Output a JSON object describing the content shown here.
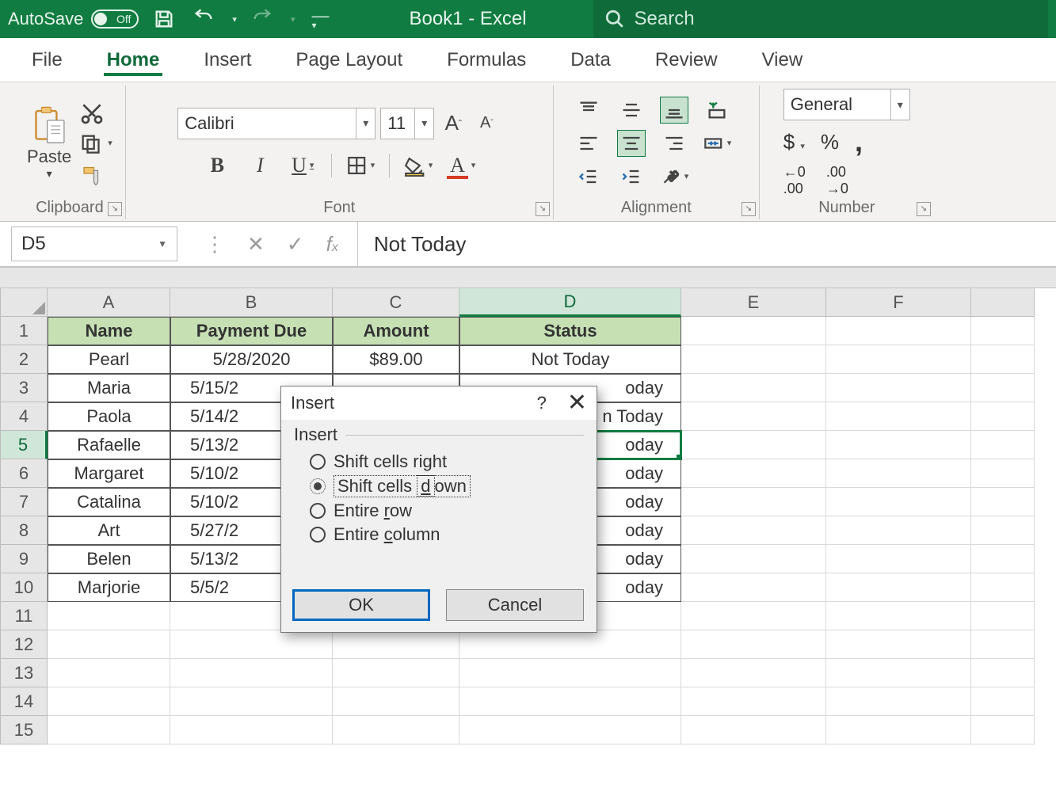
{
  "titlebar": {
    "autosave_label": "AutoSave",
    "autosave_state": "Off",
    "document_title": "Book1 - Excel",
    "search_placeholder": "Search"
  },
  "tabs": {
    "file": "File",
    "home": "Home",
    "insert": "Insert",
    "page_layout": "Page Layout",
    "formulas": "Formulas",
    "data": "Data",
    "review": "Review",
    "view": "View"
  },
  "ribbon": {
    "clipboard_label": "Clipboard",
    "paste_label": "Paste",
    "font_label": "Font",
    "font_name": "Calibri",
    "font_size": "11",
    "alignment_label": "Alignment",
    "number_label": "Number",
    "number_format": "General",
    "currency_symbol": "$",
    "percent_symbol": "%",
    "comma_symbol": ","
  },
  "namebox": {
    "ref": "D5"
  },
  "formula": {
    "value": "Not Today"
  },
  "columns": [
    "A",
    "B",
    "C",
    "D",
    "E",
    "F"
  ],
  "headers": [
    "Name",
    "Payment Due",
    "Amount",
    "Status"
  ],
  "rows": [
    {
      "n": "2",
      "name": "Pearl",
      "due": "5/28/2020",
      "amt": "$89.00",
      "status": "Not Today"
    },
    {
      "n": "3",
      "name": "Maria",
      "due": "5/15/2",
      "amt": "",
      "status": "oday"
    },
    {
      "n": "4",
      "name": "Paola",
      "due": "5/14/2",
      "amt": "",
      "status": "n Today"
    },
    {
      "n": "5",
      "name": "Rafaelle",
      "due": "5/13/2",
      "amt": "",
      "status": "oday"
    },
    {
      "n": "6",
      "name": "Margaret",
      "due": "5/10/2",
      "amt": "",
      "status": "oday"
    },
    {
      "n": "7",
      "name": "Catalina",
      "due": "5/10/2",
      "amt": "",
      "status": "oday"
    },
    {
      "n": "8",
      "name": "Art",
      "due": "5/27/2",
      "amt": "",
      "status": "oday"
    },
    {
      "n": "9",
      "name": "Belen",
      "due": "5/13/2",
      "amt": "",
      "status": "oday"
    },
    {
      "n": "10",
      "name": "Marjorie",
      "due": "5/5/2",
      "amt": "",
      "status": "oday"
    }
  ],
  "empty_rows": [
    "11",
    "12",
    "13",
    "14",
    "15"
  ],
  "dialog": {
    "title": "Insert",
    "group": "Insert",
    "options": {
      "right": "Shift cells right",
      "down": "Shift cells down",
      "row": "Entire row",
      "col": "Entire column"
    },
    "ok": "OK",
    "cancel": "Cancel",
    "help": "?"
  }
}
